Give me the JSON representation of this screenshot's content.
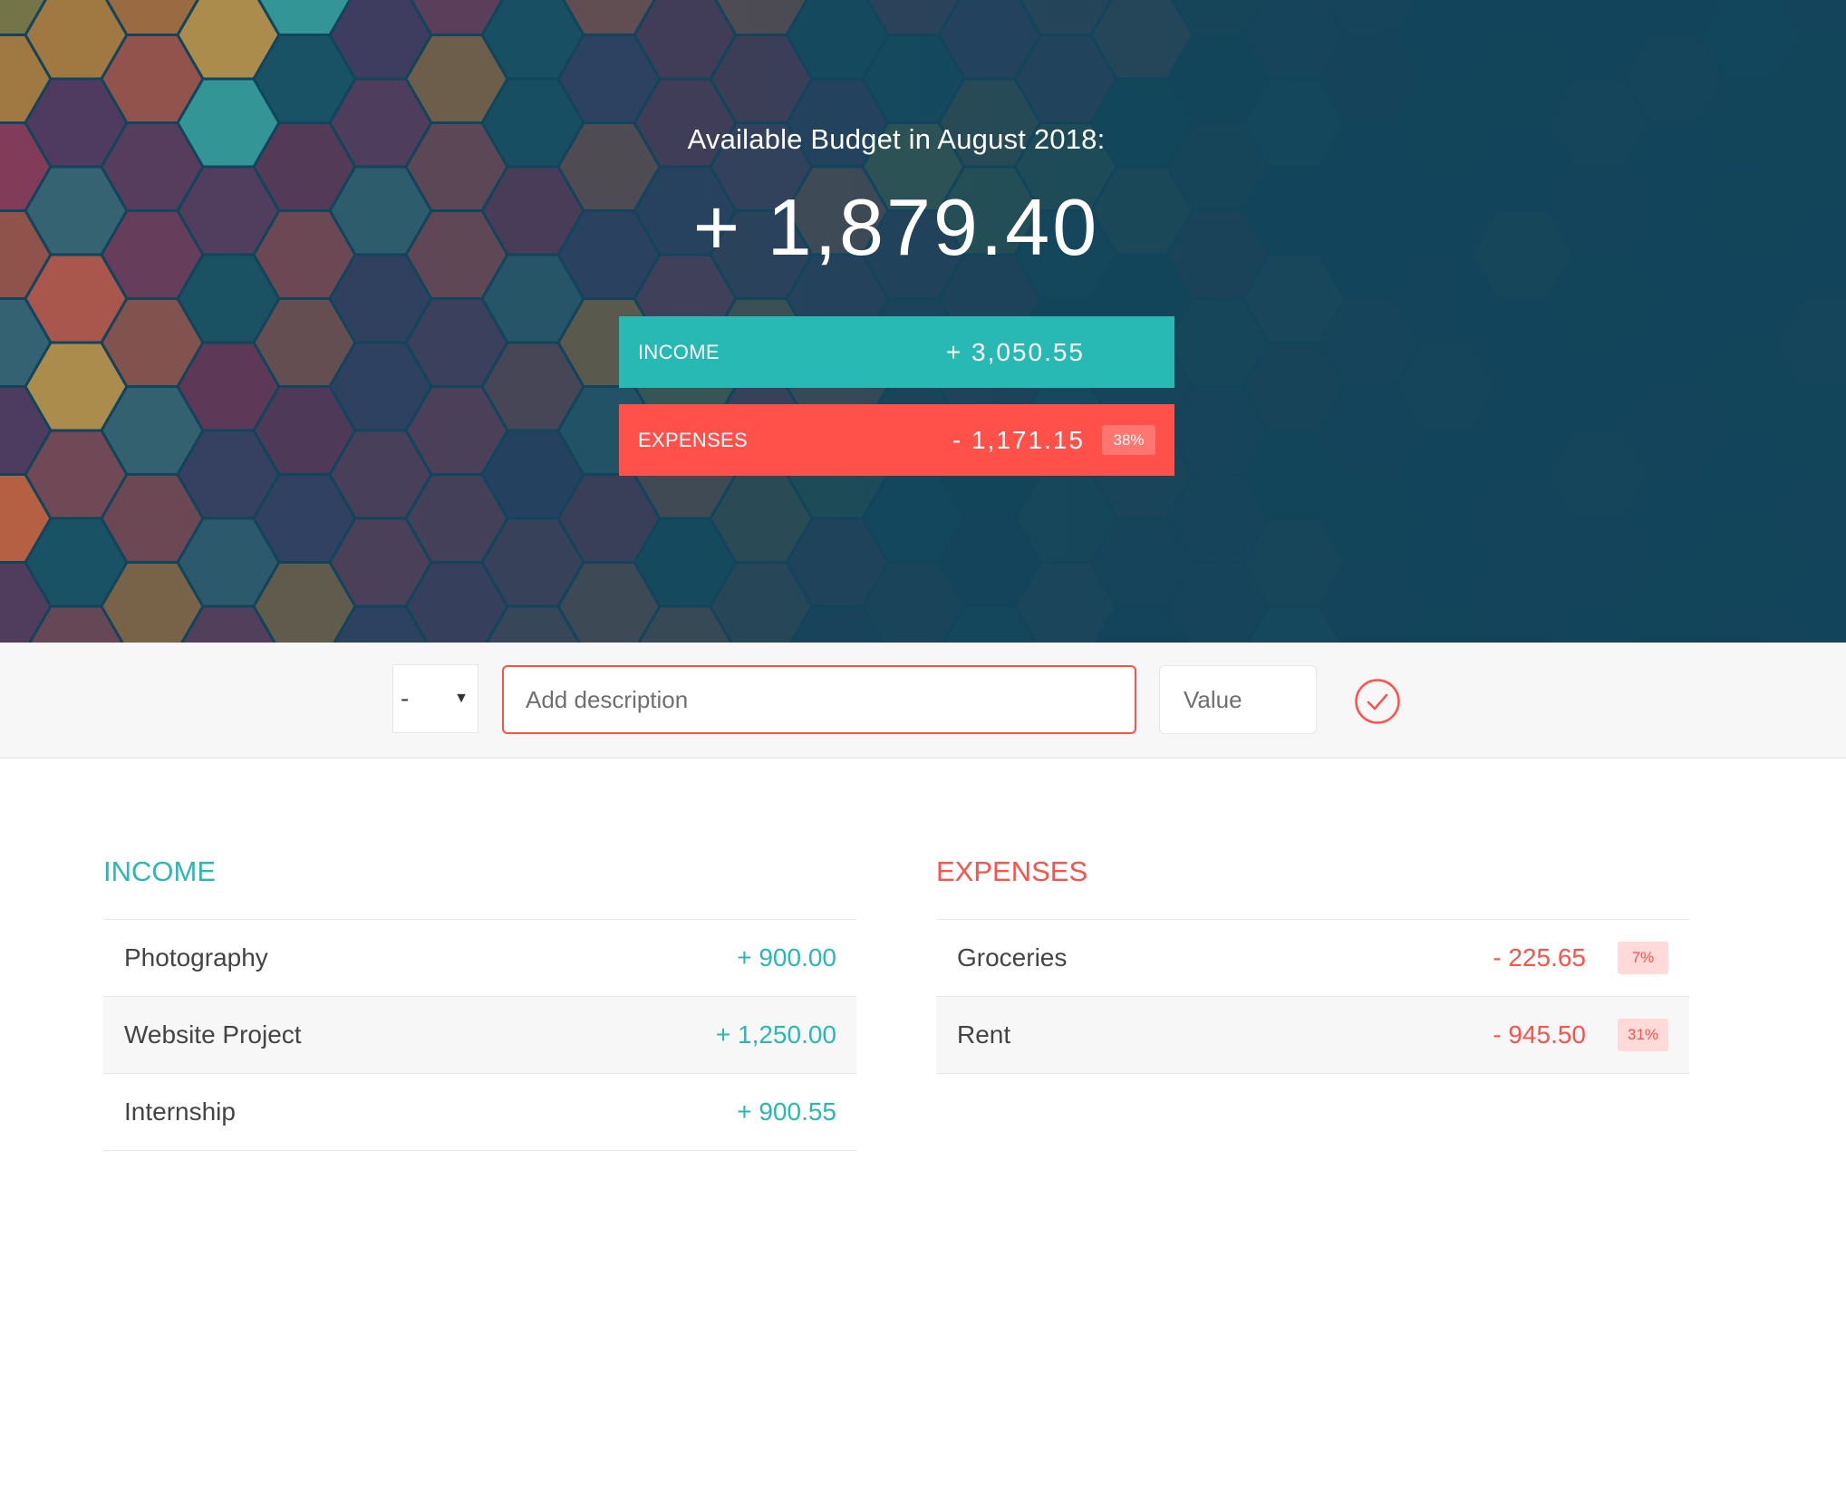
{
  "header": {
    "title": "Available Budget in August 2018:",
    "budget": "+ 1,879.40",
    "income_label": "Income",
    "income_value": "+ 3,050.55",
    "expenses_label": "Expenses",
    "expenses_value": "- 1,171.15",
    "expenses_percentage": "38%"
  },
  "add_form": {
    "type_value": "-",
    "description_placeholder": "Add description",
    "value_placeholder": "Value"
  },
  "income": {
    "title": "Income",
    "items": [
      {
        "description": "Photography",
        "value": "+ 900.00"
      },
      {
        "description": "Website Project",
        "value": "+ 1,250.00"
      },
      {
        "description": "Internship",
        "value": "+ 900.55"
      }
    ]
  },
  "expenses": {
    "title": "Expenses",
    "items": [
      {
        "description": "Groceries",
        "value": "- 225.65",
        "percentage": "7%"
      },
      {
        "description": "Rent",
        "value": "- 945.50",
        "percentage": "31%"
      }
    ]
  },
  "colors": {
    "income": "#28b9b5",
    "expenses": "#ff5049",
    "hero_background": "#12455b"
  },
  "icons": {
    "add_button": "checkmark-circle-icon",
    "type_select": "caret-down-icon"
  }
}
